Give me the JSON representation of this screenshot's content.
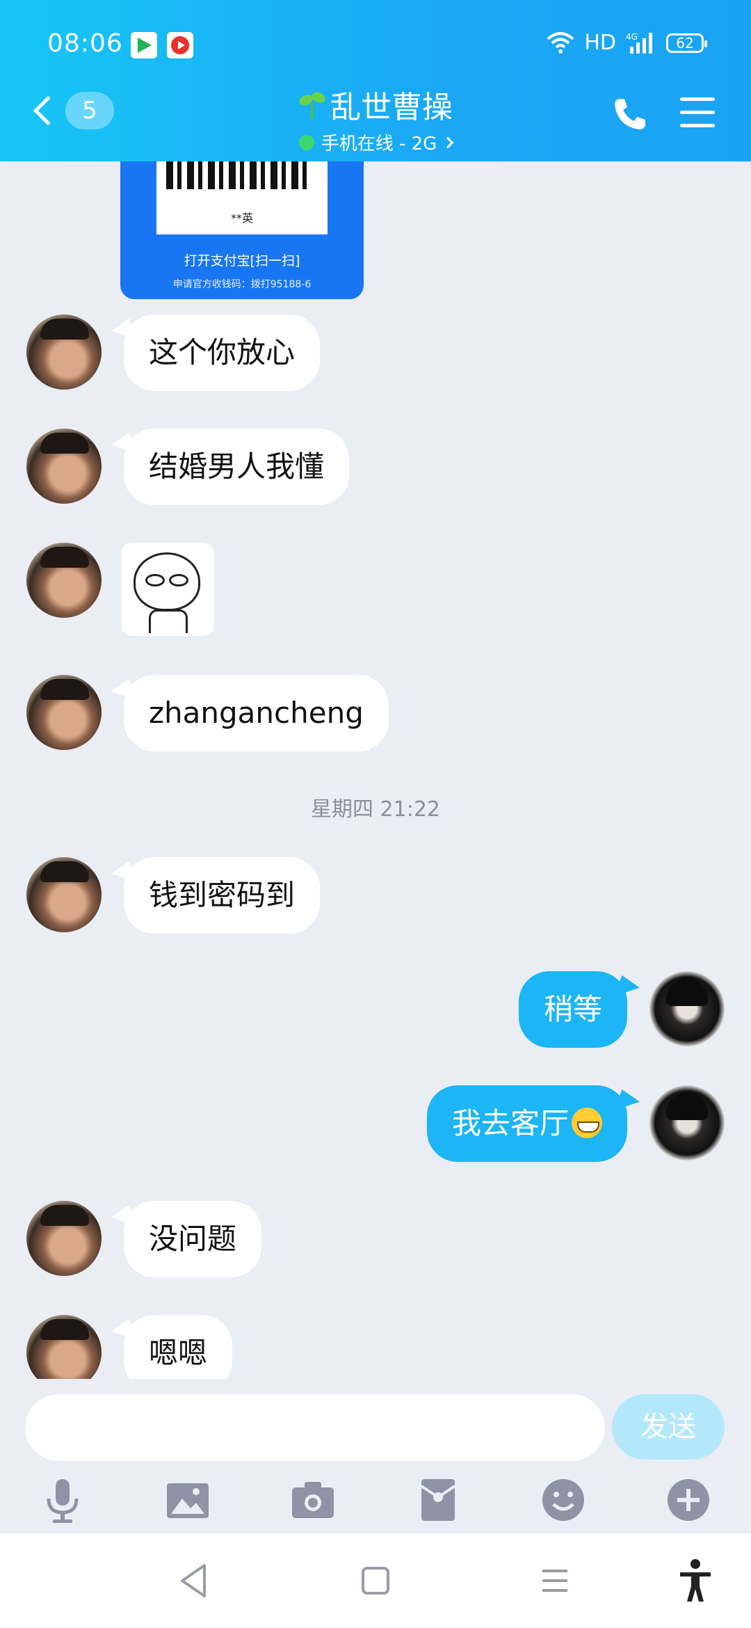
{
  "status_bar": {
    "time": "08:06",
    "hd_label": "HD",
    "network_label": "4G",
    "battery": "62"
  },
  "header": {
    "unread_count": "5",
    "contact_name": "乱世曹操",
    "presence": "手机在线 - 2G"
  },
  "qr_card": {
    "payee_name": "**英",
    "scan_text": "打开支付宝[扫一扫]",
    "footer_text": "申请官方收钱码：拨打95188-6"
  },
  "messages": [
    {
      "side": "them",
      "text": "这个你放心"
    },
    {
      "side": "them",
      "text": "结婚男人我懂"
    },
    {
      "side": "them",
      "type": "sticker"
    },
    {
      "side": "them",
      "text": "zhangancheng"
    },
    {
      "side": "them",
      "text": "钱到密码到"
    },
    {
      "side": "me",
      "text": "稍等"
    },
    {
      "side": "me",
      "text": "我去客厅"
    },
    {
      "side": "them",
      "text": "没问题"
    },
    {
      "side": "them",
      "text": "嗯嗯"
    }
  ],
  "timestamp": "星期四 21:22",
  "composer": {
    "input_value": "",
    "send_label": "发送"
  },
  "toolbar": [
    "mic-icon",
    "image-icon",
    "camera-icon",
    "red-packet-icon",
    "emoji-icon",
    "plus-icon"
  ],
  "colors": {
    "header_start": "#17c6f7",
    "header_end": "#1aa3f4",
    "my_bubble": "#1cb5f5",
    "chat_background": "#eaedf4",
    "send_button": "#b3e8fb"
  }
}
